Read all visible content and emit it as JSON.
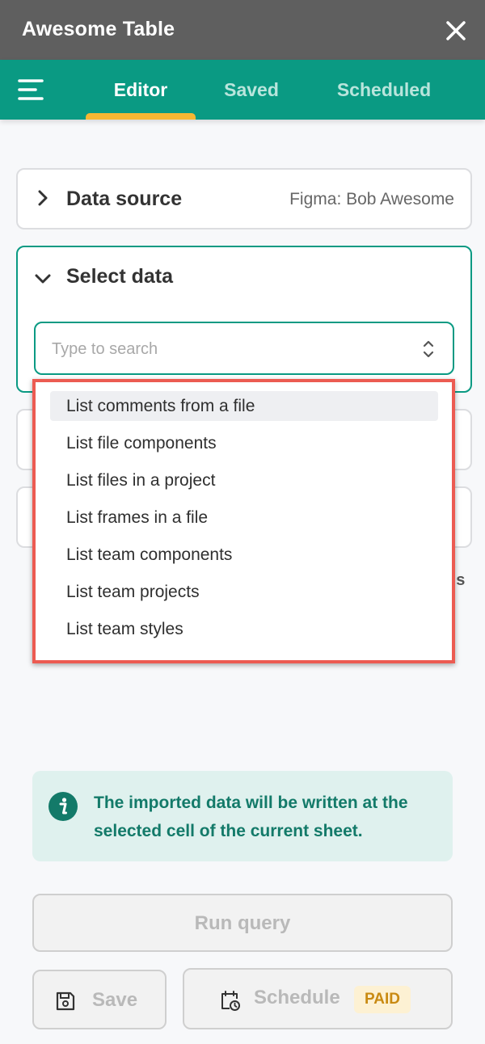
{
  "app": {
    "title": "Awesome Table"
  },
  "nav": {
    "tabs": [
      {
        "label": "Editor",
        "active": true
      },
      {
        "label": "Saved",
        "active": false
      },
      {
        "label": "Scheduled",
        "active": false
      }
    ]
  },
  "data_source": {
    "title": "Data source",
    "value": "Figma: Bob Awesome"
  },
  "select_data": {
    "title": "Select data",
    "search_placeholder": "Type to search",
    "options": [
      "List comments from a file",
      "List file components",
      "List files in a project",
      "List frames in a file",
      "List team components",
      "List team projects",
      "List team styles"
    ],
    "highlighted_index": 0
  },
  "partial_text": "gs",
  "info": {
    "text": "The imported data will be written at the selected cell of the current sheet."
  },
  "buttons": {
    "run_query": "Run query",
    "save": "Save",
    "schedule": "Schedule",
    "paid_badge": "PAID"
  },
  "colors": {
    "teal": "#0a9a83",
    "titlebar": "#5f5f5f",
    "accent": "#f7b733",
    "highlight_border": "#ec5b52"
  },
  "icons": [
    "close-icon",
    "menu-icon",
    "chevron-right-icon",
    "chevron-down-icon",
    "updown-icon",
    "info-icon",
    "save-icon",
    "calendar-clock-icon"
  ]
}
